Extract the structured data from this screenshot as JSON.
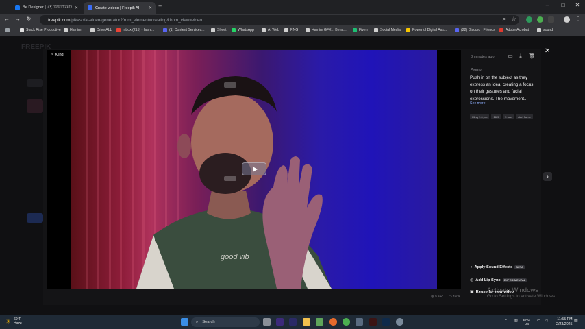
{
  "browser": {
    "tabs": [
      {
        "label": "Be Designer | এই টিউটোরিয়াল মাধ্যমে",
        "close": "✕",
        "color": "#1877f2"
      },
      {
        "label": "Create videos | Freepik AI",
        "close": "✕",
        "color": "#3b6cf6"
      }
    ],
    "new_tab": "+",
    "window_controls": [
      "–",
      "□",
      "✕"
    ],
    "url_host": "freepik.com",
    "url_rest": "/pikaso/ai-video-generator?from_element=creating&from_view=video",
    "bookmarks": [
      {
        "label": "Stack Rise Productive",
        "color": "#e0e0e0"
      },
      {
        "label": "Hamim",
        "color": "#cfcfcf"
      },
      {
        "label": "Drive ALL",
        "color": "#cfcfcf"
      },
      {
        "label": "Inbox (215) - hami...",
        "color": "#ea4335"
      },
      {
        "label": "(1) Content Services...",
        "color": "#5865f2"
      },
      {
        "label": "Sheet",
        "color": "#cfcfcf"
      },
      {
        "label": "WhatsApp",
        "color": "#25d366"
      },
      {
        "label": "AI Web",
        "color": "#cfcfcf"
      },
      {
        "label": "PNG",
        "color": "#cfcfcf"
      },
      {
        "label": "Hamim GFX :: Beha...",
        "color": "#cfcfcf"
      },
      {
        "label": "Fiverr",
        "color": "#1dbf73"
      },
      {
        "label": "Social Media",
        "color": "#cfcfcf"
      },
      {
        "label": "Powerful Digital Ass...",
        "color": "#f7c600"
      },
      {
        "label": "(22) Discord | Friends",
        "color": "#5865f2"
      },
      {
        "label": "Adobe Acrobat",
        "color": "#e03a2f"
      },
      {
        "label": "sound",
        "color": "#cfcfcf"
      }
    ]
  },
  "modal": {
    "model_tag": "Kling",
    "time_ago": "8 minutes ago",
    "prompt_heading": "Prompt",
    "prompt_text": "Push in on the subject as they express an idea, creating a focus on their gestures and facial expressions. The movement...",
    "see_more": "See more",
    "chips": [
      "Kling 1.6 pro",
      "16:9",
      "5 sec",
      "start frame"
    ],
    "actions": [
      {
        "label": "Apply Sound Effects",
        "badge": "BETA",
        "icon": "sound-effects-icon"
      },
      {
        "label": "Add Lip Sync",
        "badge": "EXPERIMENTAL",
        "icon": "lip-sync-icon"
      },
      {
        "label": "Reuse for new video",
        "badge": "",
        "icon": "reuse-icon"
      }
    ],
    "meta_duration": "5 sec",
    "meta_ratio": "16:9"
  },
  "watermark": {
    "line1": "Activate Windows",
    "line2": "Go to Settings to activate Windows."
  },
  "taskbar": {
    "weather_temp": "69°F",
    "weather_desc": "Haze",
    "search_placeholder": "Search",
    "tray_lang_1": "ENG",
    "tray_lang_2": "US",
    "time": "11:55 PM",
    "date": "2/23/2025"
  }
}
